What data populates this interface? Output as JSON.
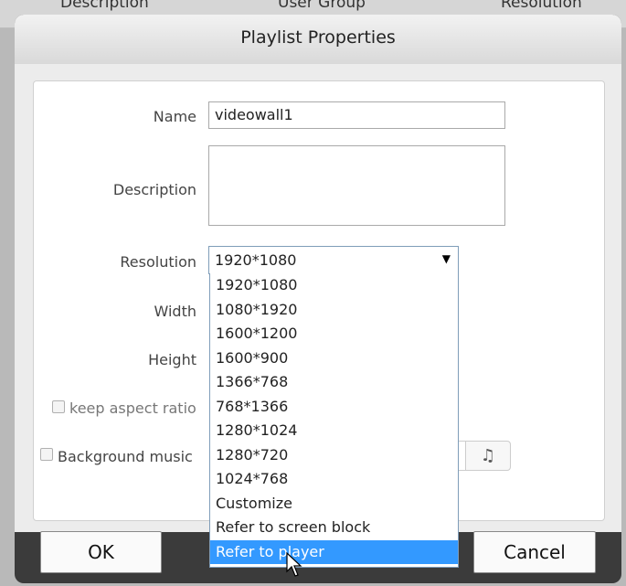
{
  "background_table": {
    "columns": [
      "Description",
      "User Group",
      "Resolution"
    ]
  },
  "dialog": {
    "title": "Playlist Properties",
    "fields": {
      "name_label": "Name",
      "name_value": "videowall1",
      "description_label": "Description",
      "description_value": "",
      "resolution_label": "Resolution",
      "resolution_value": "1920*1080",
      "width_label": "Width",
      "height_label": "Height",
      "keep_aspect_label": "keep aspect ratio",
      "bg_music_label": "Background music"
    },
    "resolution_options": [
      "1920*1080",
      "1080*1920",
      "1600*1200",
      "1600*900",
      "1366*768",
      "768*1366",
      "1280*1024",
      "1280*720",
      "1024*768",
      "Customize",
      "Refer to screen block",
      "Refer to player"
    ],
    "highlighted_option_index": 11,
    "ok_label": "OK",
    "cancel_label": "Cancel",
    "music_icon_glyph": "♫"
  },
  "colors": {
    "dialog_frame": "#3b3b3b",
    "highlight": "#3399ff"
  },
  "icons": {
    "dropdown": "triangle-down-icon",
    "music": "music-note-icon",
    "cursor": "mouse-pointer-icon"
  }
}
